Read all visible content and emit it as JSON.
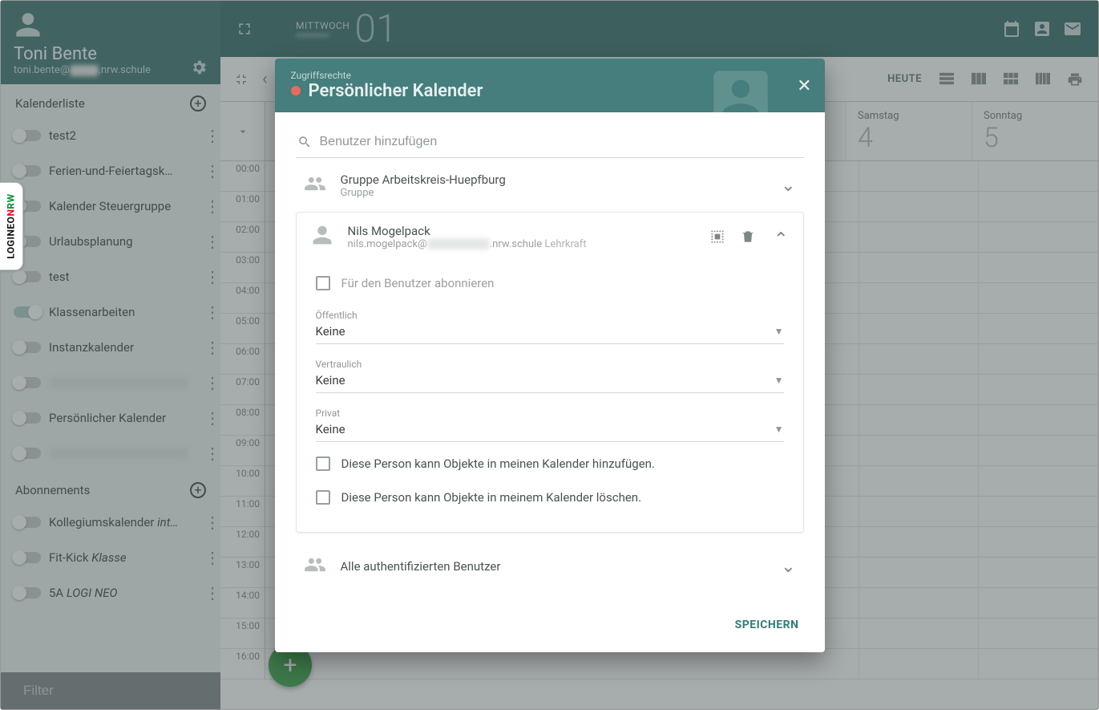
{
  "user": {
    "name": "Toni Bente",
    "email_prefix": "toni.bente@",
    "email_suffix": ".nrw.schule"
  },
  "sidebar": {
    "calendars_title": "Kalenderliste",
    "subscriptions_title": "Abonnements",
    "filter_placeholder": "Filter",
    "calendars": [
      {
        "label": "test2",
        "on": false
      },
      {
        "label": "Ferien-und-Feiertagsk…",
        "on": false
      },
      {
        "label": "Kalender Steuergruppe",
        "on": false
      },
      {
        "label": "Urlaubsplanung",
        "on": false
      },
      {
        "label": "test",
        "on": false
      },
      {
        "label": "Klassenarbeiten",
        "on": true
      },
      {
        "label": "Instanzkalender",
        "on": false
      },
      {
        "label": "",
        "on": false,
        "blur": true
      },
      {
        "label": "Persönlicher Kalender",
        "on": false
      },
      {
        "label": "",
        "on": false,
        "blur": true
      }
    ],
    "subscriptions": [
      {
        "label": "Kollegiumskalender",
        "italic_suffix": "int…"
      },
      {
        "label": "Fit-Kick",
        "italic_suffix": "Klasse"
      },
      {
        "label": "5A",
        "italic_suffix": "LOGI NEO"
      }
    ]
  },
  "topbar": {
    "day_name": "MITTWOCH",
    "day_num": "01"
  },
  "toolbar": {
    "today": "HEUTE"
  },
  "week": {
    "days": [
      {
        "name": "Samstag",
        "num": "4"
      },
      {
        "name": "Sonntag",
        "num": "5"
      }
    ],
    "hours": [
      "00:00",
      "01:00",
      "02:00",
      "03:00",
      "04:00",
      "05:00",
      "06:00",
      "07:00",
      "08:00",
      "09:00",
      "10:00",
      "11:00",
      "12:00",
      "13:00",
      "14:00",
      "15:00",
      "16:00"
    ]
  },
  "dialog": {
    "breadcrumb": "Zugriffsrechte",
    "title": "Persönlicher Kalender",
    "search_placeholder": "Benutzer hinzufügen",
    "save_label": "SPEICHERN",
    "group": {
      "name": "Gruppe Arbeitskreis-Huepfburg",
      "sub": "Gruppe"
    },
    "user": {
      "name": "Nils Mogelpack",
      "email_prefix": "nils.mogelpack@",
      "email_suffix": ".nrw.schule",
      "role": "Lehrkraft"
    },
    "subscribe_label": "Für den Benutzer abonnieren",
    "selects": {
      "public_label": "Öffentlich",
      "public_value": "Keine",
      "conf_label": "Vertraulich",
      "conf_value": "Keine",
      "priv_label": "Privat",
      "priv_value": "Keine"
    },
    "perm_add": "Diese Person kann Objekte in meinen Kalender hinzufügen.",
    "perm_del": "Diese Person kann Objekte in meinem Kalender löschen.",
    "all_users": "Alle authentifizierten Benutzer"
  },
  "logo": {
    "part1": "LOGINEO",
    "part2": "N",
    "part3": "RW"
  }
}
